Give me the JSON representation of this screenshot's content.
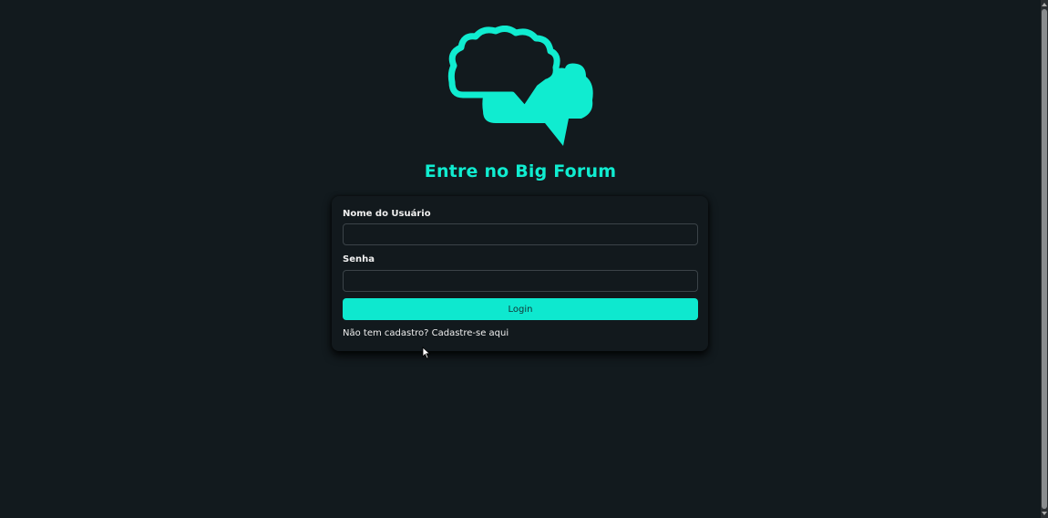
{
  "page": {
    "title": "Entre no Big Forum",
    "logo_icon": "chat-bubbles-icon",
    "accent_color": "#0ee8cf"
  },
  "form": {
    "username_label": "Nome do Usuário",
    "username_value": "",
    "password_label": "Senha",
    "password_value": "",
    "login_button_label": "Login",
    "register_prompt": "Não tem cadastro?",
    "register_link": "Cadastre-se aqui"
  }
}
